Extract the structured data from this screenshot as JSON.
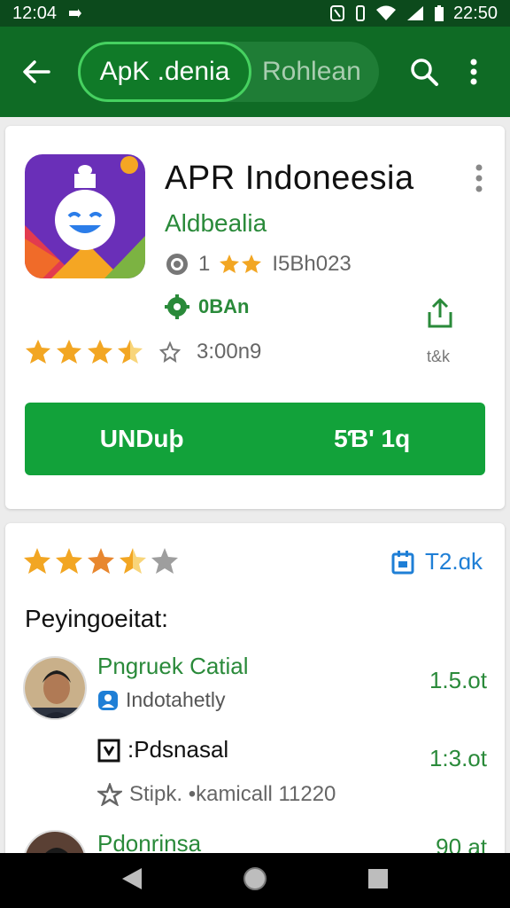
{
  "status": {
    "time_left": "12:04",
    "time_right": "22:50"
  },
  "appbar": {
    "tab_active": "ApK .denia",
    "tab_inactive": "Rohlean"
  },
  "app": {
    "title": "APR Indoneesia",
    "developer": "Aldbealia",
    "meta_text": "1",
    "meta_code": "I5Bh023",
    "badge": "0BAn",
    "rating_value": 4.5,
    "downloads": "3:00n9",
    "share_label": "t&k",
    "install_left": "UNDuþ",
    "install_right": "5Ɓ' 1q"
  },
  "reviews": {
    "rating_value": 3.5,
    "count": "T2.ɑk",
    "title": "Peyingoeitat:",
    "items": [
      {
        "name": "Pngruek Catial",
        "subtitle": "Indotahetly",
        "value": "1.5.ot"
      },
      {
        "text": ":Pdsnasal",
        "meta": "Stipk. •kamicall 11220",
        "value": "1:3.ot"
      },
      {
        "name": "Pdonrinsa",
        "value": "90 at"
      }
    ]
  },
  "colors": {
    "brand_dark": "#0f6b25",
    "brand_green": "#12a23a",
    "accent_blue": "#1f7fd6",
    "star": "#f2a623"
  },
  "icons": [
    "back-arrow-icon",
    "search-icon",
    "more-vert-icon",
    "share-icon",
    "back-triangle-icon",
    "home-circle-icon",
    "recents-square-icon"
  ]
}
